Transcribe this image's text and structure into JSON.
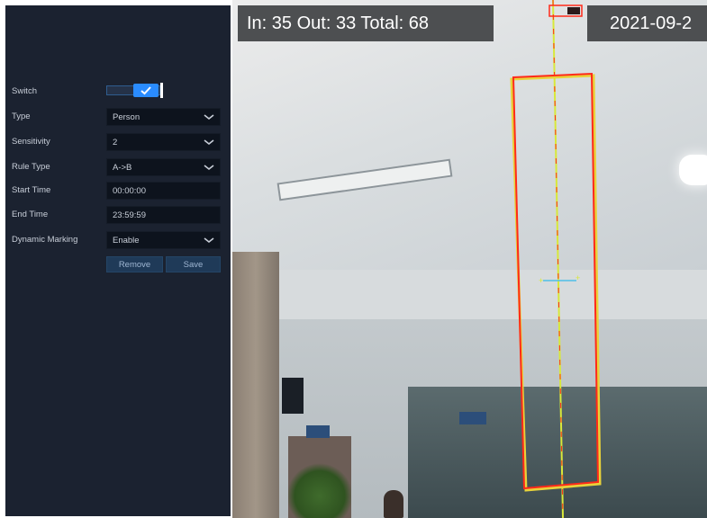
{
  "settings": {
    "switch": {
      "label": "Switch",
      "on": true
    },
    "type": {
      "label": "Type",
      "value": "Person"
    },
    "sensitivity": {
      "label": "Sensitivity",
      "value": "2"
    },
    "rule_type": {
      "label": "Rule Type",
      "value": "A->B"
    },
    "start_time": {
      "label": "Start Time",
      "value": "00:00:00"
    },
    "end_time": {
      "label": "End Time",
      "value": "23:59:59"
    },
    "dynamic_marking": {
      "label": "Dynamic Marking",
      "value": "Enable"
    },
    "remove_label": "Remove",
    "save_label": "Save"
  },
  "video": {
    "counter_text": "In: 35  Out: 33  Total: 68",
    "datetime_text": "2021-09-2"
  },
  "colors": {
    "panel_bg": "#1b2230",
    "field_bg": "#0d131d",
    "accent": "#2a8cff",
    "zone_line": "#ff2a1a",
    "cross_line": "#d8e83a"
  },
  "icons": [
    "check-icon",
    "chevron-down-icon"
  ]
}
